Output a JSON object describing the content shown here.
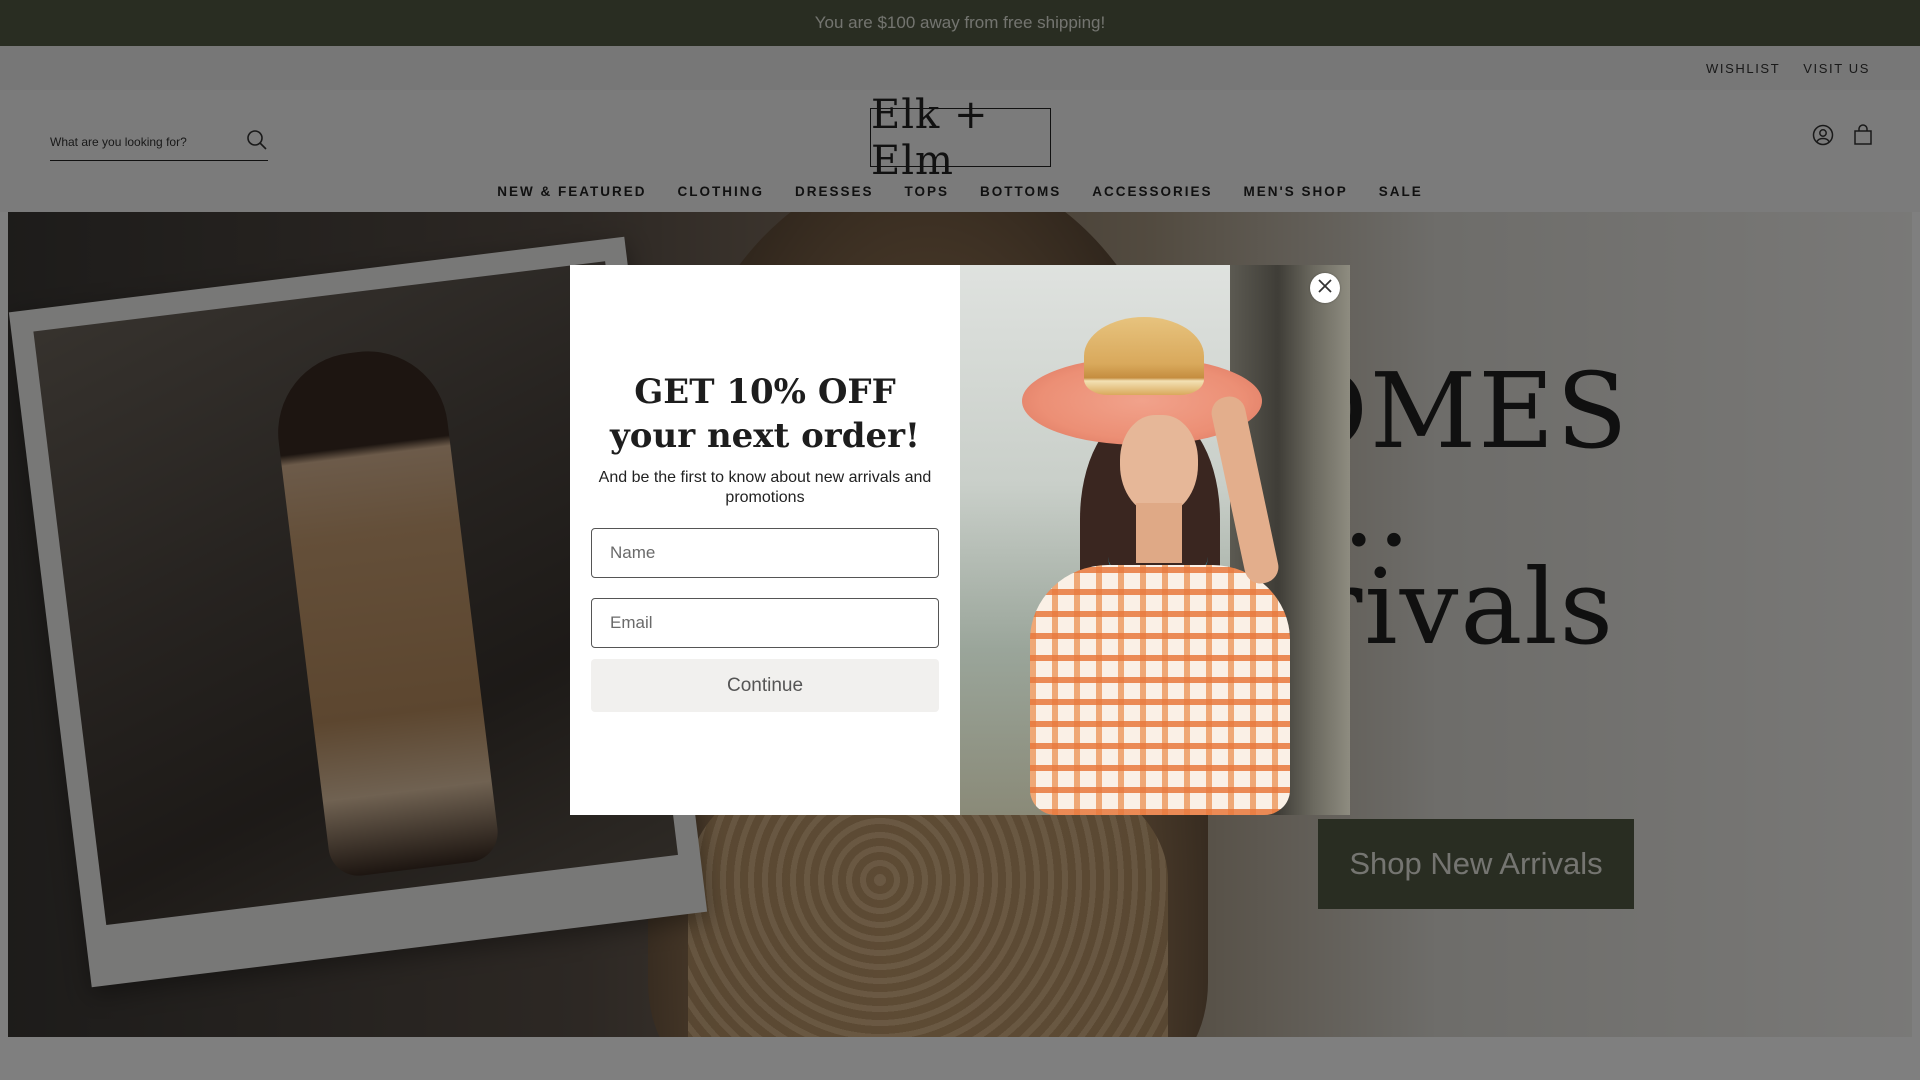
{
  "announcement": {
    "text": "You are $100 away from free shipping!"
  },
  "utility_links": {
    "wishlist": "WISHLIST",
    "visit_us": "VISIT US"
  },
  "header": {
    "search_placeholder": "What are you looking for?",
    "logo": "Elk + Elm",
    "icons": [
      "search-icon",
      "account-icon",
      "cart-icon"
    ]
  },
  "nav": [
    {
      "label": "NEW & FEATURED"
    },
    {
      "label": "CLOTHING"
    },
    {
      "label": "DRESSES"
    },
    {
      "label": "TOPS"
    },
    {
      "label": "BOTTOMS"
    },
    {
      "label": "ACCESSORIES"
    },
    {
      "label": "MEN'S SHOP"
    },
    {
      "label": "SALE"
    }
  ],
  "hero": {
    "headline_lines": [
      "E COMES",
      "ALL...",
      "y Arrivals"
    ],
    "cta": "Shop New Arrivals"
  },
  "modal": {
    "title_line1": "GET 10% OFF",
    "title_line2": "your next order!",
    "subtitle": "And be the first to know about new arrivals and promotions",
    "name_placeholder": "Name",
    "email_placeholder": "Email",
    "continue_label": "Continue"
  },
  "colors": {
    "announcement_bg": "#525b45",
    "cta_bg": "#525b45",
    "overlay": "rgba(0,0,0,0.5)"
  }
}
